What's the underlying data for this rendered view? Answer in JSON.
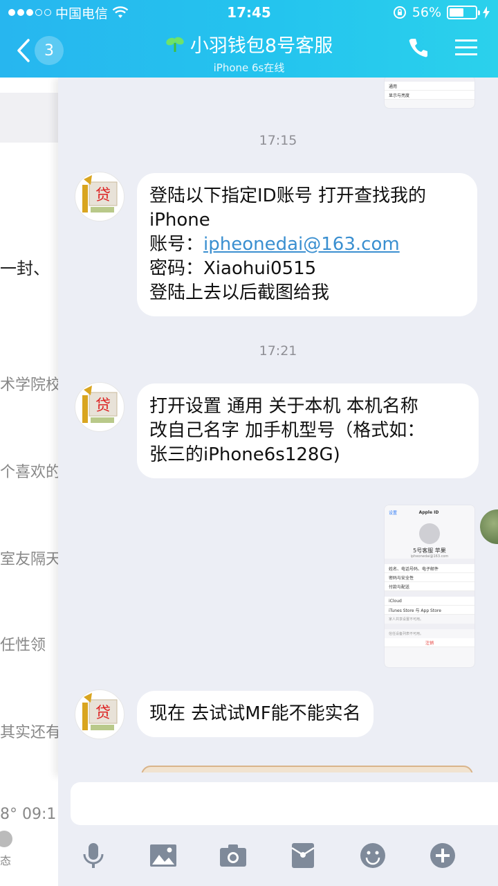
{
  "status_bar": {
    "carrier": "中国电信",
    "time": "17:45",
    "battery_percent": "56%",
    "battery_level": 0.56
  },
  "nav": {
    "back_count": "3",
    "title": "小羽钱包8号客服",
    "subtitle": "iPhone 6s在线"
  },
  "background_list": {
    "snippets": [
      "一封、",
      "术学院校",
      "个喜欢的",
      "室友隔天",
      "任性领",
      "其实还有",
      "8°  09:1",
      "态"
    ]
  },
  "chat": {
    "top_shot_rows": [
      "通用",
      "显示与亮度"
    ],
    "messages": [
      {
        "time": "17:15",
        "lines": [
          "登陆以下指定ID账号 打开查找我的",
          "iPhone"
        ],
        "account_label": "账号：",
        "account_link": "ipheonedai@163.com",
        "password_line": "密码：Xiaohui0515",
        "closing_line": "登陆上去以后截图给我"
      },
      {
        "time": "17:21",
        "lines": [
          "打开设置 通用 关于本机 本机名称",
          "改自己名字 加手机型号（格式如：",
          "张三的iPhone6s128G)"
        ]
      },
      {
        "lines": [
          "现在 去试试MF能不能实名"
        ]
      }
    ],
    "apple_id_shot": {
      "back": "设置",
      "title": "Apple ID",
      "name": "5号客服 苹果",
      "email": "ipheonedai@163.com",
      "rows1": [
        "姓名、电话号码、电子邮件",
        "密码与安全性",
        "付款与配送"
      ],
      "rows2": [
        "iCloud",
        "iTunes Store 与 App Store"
      ],
      "note1": "家人共享设置不可用。",
      "note2": "信任设备列表不可用。",
      "signout": "注销"
    }
  },
  "toolbar": {
    "icons": [
      "microphone-icon",
      "image-icon",
      "camera-icon",
      "red-packet-icon",
      "emoji-icon",
      "plus-icon"
    ]
  }
}
